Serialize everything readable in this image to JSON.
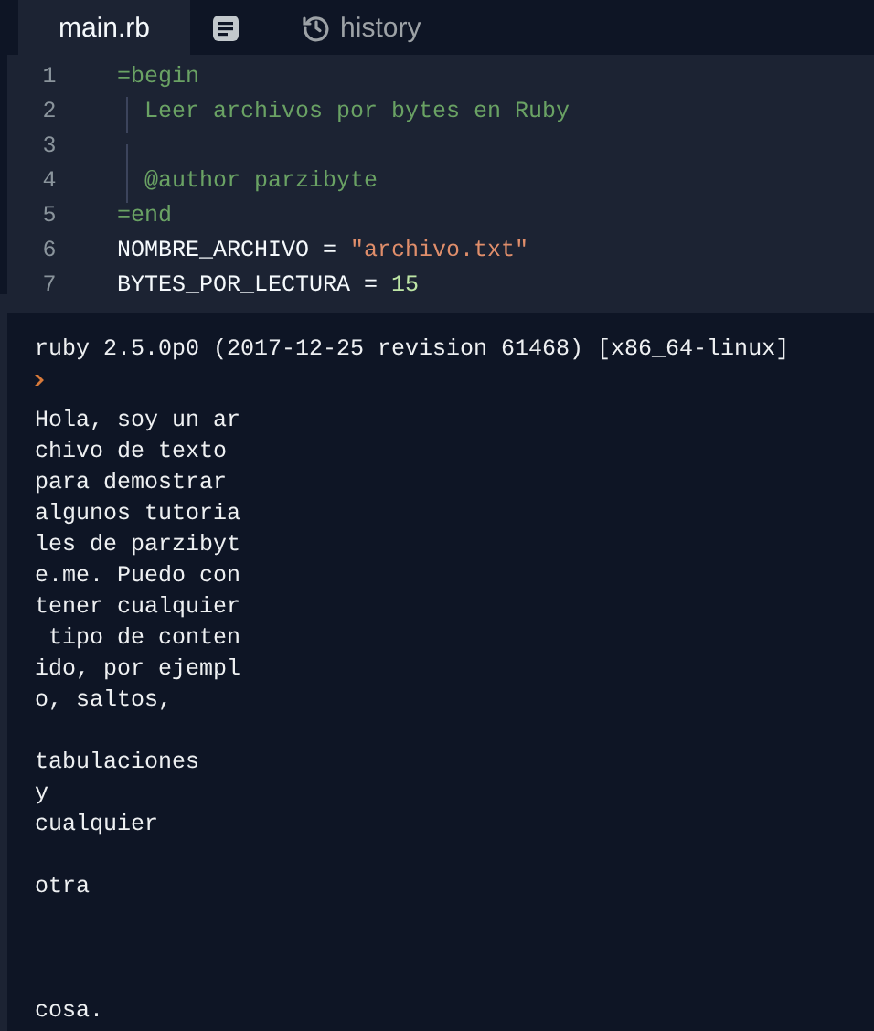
{
  "tabs": [
    {
      "kind": "text",
      "label": "main.rb",
      "selected": true
    },
    {
      "kind": "document",
      "selected": false
    },
    {
      "kind": "history",
      "label": "history",
      "selected": false
    }
  ],
  "editor": {
    "lines": [
      {
        "number": "1",
        "guide": false,
        "tokens": [
          {
            "kind": "comment",
            "text": "=begin"
          }
        ]
      },
      {
        "number": "2",
        "guide": true,
        "tokens": [
          {
            "kind": "comment",
            "text": "  Leer archivos por bytes en Ruby"
          }
        ]
      },
      {
        "number": "3",
        "guide": true
      },
      {
        "number": "4",
        "guide": true,
        "tokens": [
          {
            "kind": "comment",
            "text": "  @author parzibyte"
          }
        ]
      },
      {
        "number": "5",
        "guide": false,
        "tokens": [
          {
            "kind": "comment",
            "text": "=end"
          }
        ]
      },
      {
        "number": "6",
        "guide": false,
        "tokens": [
          {
            "kind": "plain",
            "text": "NOMBRE_ARCHIVO = "
          },
          {
            "kind": "string",
            "text": "\"archivo.txt\""
          }
        ]
      },
      {
        "number": "7",
        "guide": false,
        "tokens": [
          {
            "kind": "plain",
            "text": "BYTES_POR_LECTURA = "
          },
          {
            "kind": "number",
            "text": "15"
          }
        ]
      }
    ]
  },
  "console": {
    "version": "ruby 2.5.0p0 (2017-12-25 revision 61468) [x86_64-linux]",
    "output": [
      {
        "kind": "text",
        "text": "Hola, soy un ar"
      },
      {
        "kind": "text",
        "text": "chivo de texto"
      },
      {
        "kind": "text",
        "text": "para demostrar"
      },
      {
        "kind": "text",
        "text": "algunos tutoria"
      },
      {
        "kind": "text",
        "text": "les de parzibyt"
      },
      {
        "kind": "text",
        "text": "e.me. Puedo con"
      },
      {
        "kind": "text",
        "text": "tener cualquier"
      },
      {
        "kind": "text",
        "text": " tipo de conten"
      },
      {
        "kind": "text",
        "text": "ido, por ejempl"
      },
      {
        "kind": "text",
        "text": "o, saltos,"
      },
      {
        "kind": "blank"
      },
      {
        "kind": "text",
        "text": "tabulaciones"
      },
      {
        "kind": "text",
        "text": "y"
      },
      {
        "kind": "text",
        "text": "cualquier"
      },
      {
        "kind": "blank"
      },
      {
        "kind": "text",
        "text": "otra"
      },
      {
        "kind": "blank"
      },
      {
        "kind": "blank"
      },
      {
        "kind": "blank"
      },
      {
        "kind": "text",
        "text": "cosa."
      }
    ]
  }
}
